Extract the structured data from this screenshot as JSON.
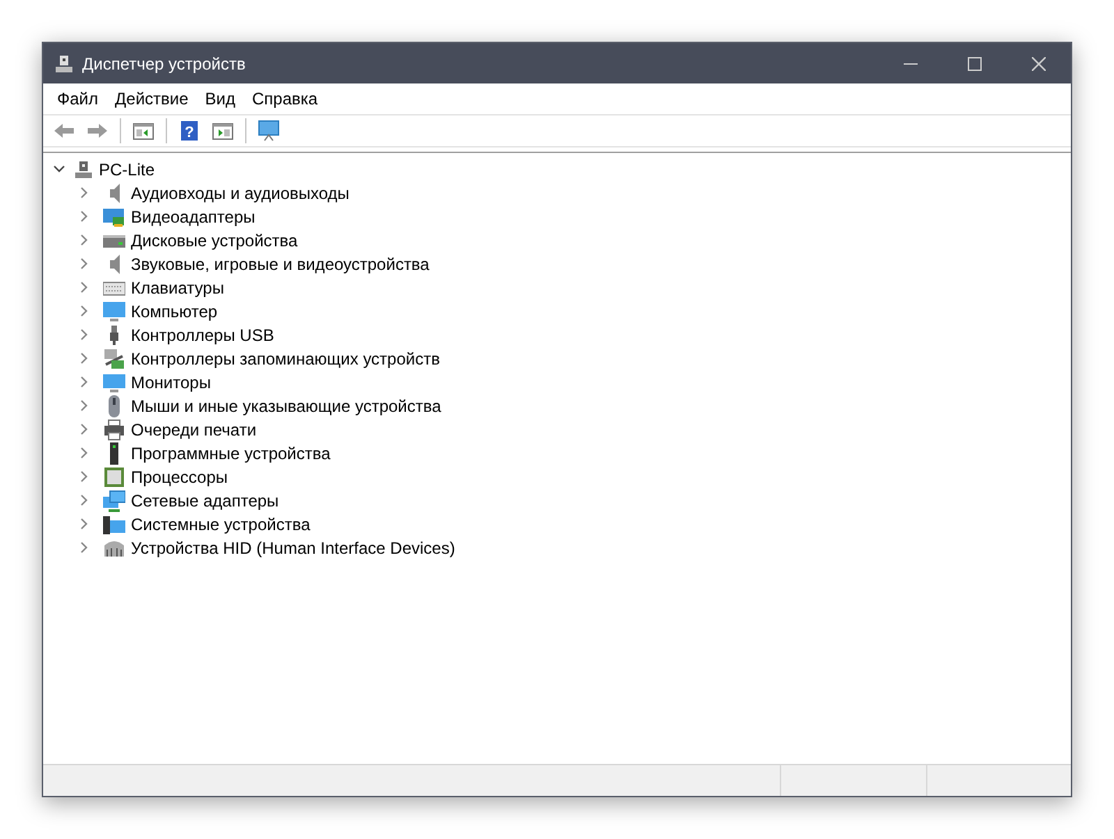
{
  "window": {
    "title": "Диспетчер устройств"
  },
  "menu": [
    "Файл",
    "Действие",
    "Вид",
    "Справка"
  ],
  "toolbar": [
    {
      "kind": "back",
      "disabled": true
    },
    {
      "kind": "forward",
      "disabled": true
    },
    {
      "kind": "separator"
    },
    {
      "kind": "pane"
    },
    {
      "kind": "separator"
    },
    {
      "kind": "help",
      "label": "?"
    },
    {
      "kind": "pane2"
    },
    {
      "kind": "separator"
    },
    {
      "kind": "monitor"
    }
  ],
  "tree": {
    "label": "PC-Lite",
    "expanded": true,
    "children": [
      {
        "label": "Аудиовходы и аудиовыходы",
        "expanded": false
      },
      {
        "label": "Видеоадаптеры",
        "expanded": false
      },
      {
        "label": "Дисковые устройства",
        "expanded": false
      },
      {
        "label": "Звуковые, игровые и видеоустройства",
        "expanded": false
      },
      {
        "label": "Клавиатуры",
        "expanded": false
      },
      {
        "label": "Компьютер",
        "expanded": false
      },
      {
        "label": "Контроллеры USB",
        "expanded": false
      },
      {
        "label": "Контроллеры запоминающих устройств",
        "expanded": false
      },
      {
        "label": "Мониторы",
        "expanded": false
      },
      {
        "label": "Мыши и иные указывающие устройства",
        "expanded": false
      },
      {
        "label": "Очереди печати",
        "expanded": false
      },
      {
        "label": "Программные устройства",
        "expanded": false
      },
      {
        "label": "Процессоры",
        "expanded": false
      },
      {
        "label": "Сетевые адаптеры",
        "expanded": false
      },
      {
        "label": "Системные устройства",
        "expanded": false
      },
      {
        "label": "Устройства HID (Human Interface Devices)",
        "expanded": false
      }
    ]
  }
}
